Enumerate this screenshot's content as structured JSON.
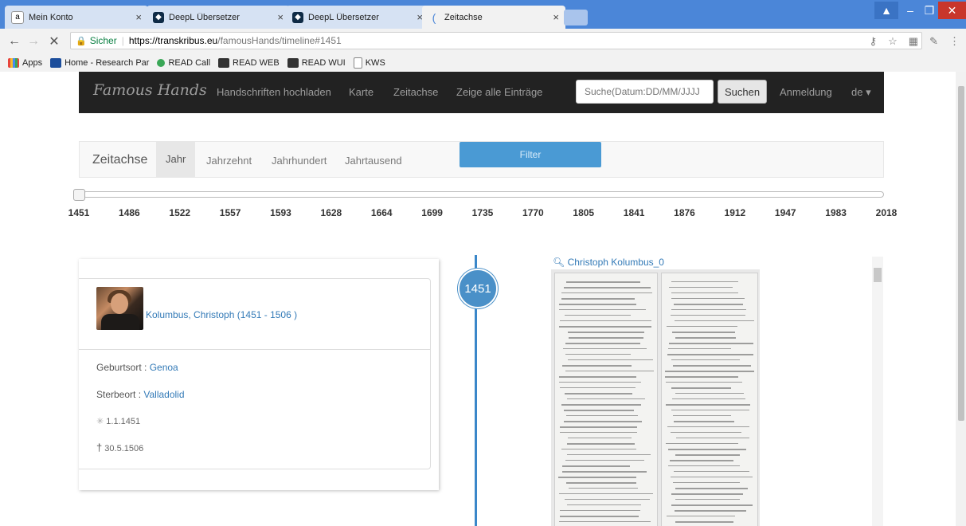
{
  "browser": {
    "tabs": [
      {
        "title": "Mein Konto",
        "favicon": "amazon-icon",
        "color": "#ffffff"
      },
      {
        "title": "DeepL Übersetzer",
        "favicon": "deepl-icon",
        "color": "#0f2b46"
      },
      {
        "title": "DeepL Übersetzer",
        "favicon": "deepl-icon",
        "color": "#0f2b46"
      },
      {
        "title": "Zeitachse",
        "favicon": "loading-icon",
        "color": "#4b86d8"
      }
    ],
    "url_secure_label": "Sicher",
    "url_host": "https://transkribus.eu",
    "url_path": "/famousHands/timeline#1451",
    "bookmarks": [
      {
        "label": "Apps",
        "icon": "apps-grid-icon"
      },
      {
        "label": "Home - Research Par",
        "icon": "bookmark-blue-icon"
      },
      {
        "label": "READ Call",
        "icon": "green-dot-icon"
      },
      {
        "label": "READ WEB",
        "icon": "read-logo-icon"
      },
      {
        "label": "READ WUI",
        "icon": "read-logo-icon"
      },
      {
        "label": "KWS",
        "icon": "page-icon"
      }
    ]
  },
  "navbar": {
    "brand": "Famous Hands",
    "links": [
      "Handschriften hochladen",
      "Karte",
      "Zeitachse",
      "Zeige alle Einträge"
    ],
    "search_placeholder": "Suche(Datum:DD/MM/JJJJ",
    "search_button": "Suchen",
    "login": "Anmeldung",
    "language": "de ▾"
  },
  "timebar": {
    "title": "Zeitachse",
    "items": [
      "Jahr",
      "Jahrzehnt",
      "Jahrhundert",
      "Jahrtausend"
    ],
    "active_index": 0,
    "filter_label": "Filter"
  },
  "timeline_ticks": [
    "1451",
    "1486",
    "1522",
    "1557",
    "1593",
    "1628",
    "1664",
    "1699",
    "1735",
    "1770",
    "1805",
    "1841",
    "1876",
    "1912",
    "1947",
    "1983",
    "2018"
  ],
  "selected_year": "1451",
  "person": {
    "name": "Kolumbus, Christoph (1451 - 1506 )",
    "birthplace_label": "Geburtsort :",
    "birthplace": "Genoa",
    "deathplace_label": "Sterbeort :",
    "deathplace": "Valladolid",
    "birth_symbol": "✳",
    "birth_date": "1.1.1451",
    "death_symbol": "†",
    "death_date": "30.5.1506"
  },
  "document": {
    "title": "Christoph Kolumbus_0",
    "icon": "zoom-in-icon"
  },
  "colors": {
    "accent": "#337ab7",
    "timeline": "#3a87c9",
    "navbar": "#222222",
    "chrome": "#4b86d8"
  }
}
